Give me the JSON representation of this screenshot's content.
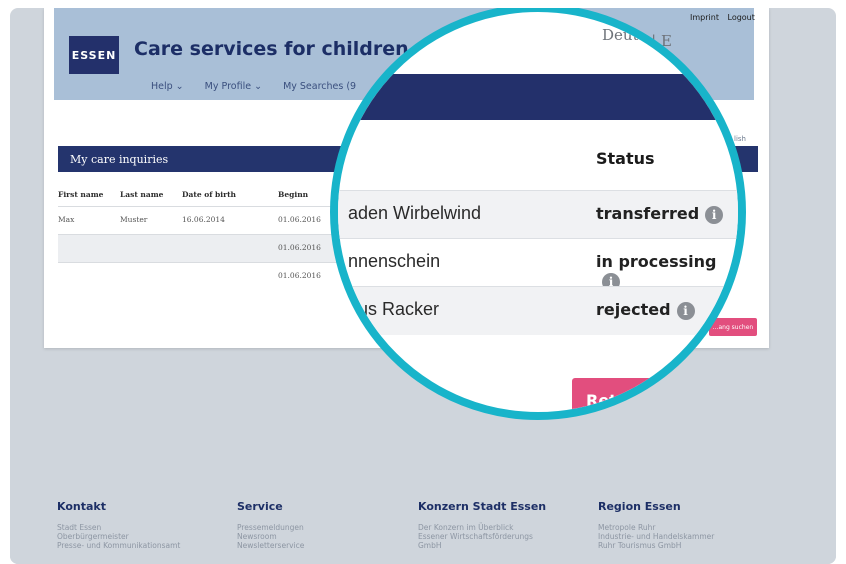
{
  "header": {
    "logo_text": "ESSEN",
    "title": "Care services for children",
    "nav": [
      "Help ⌄",
      "My Profile ⌄",
      "My Searches (9"
    ],
    "language": "Deutsch | E",
    "top_links": [
      "Imprint",
      "Logout"
    ],
    "english_link": "lish"
  },
  "inquiries": {
    "heading": "My care inquiries",
    "columns": [
      "First name",
      "Last name",
      "Date of birth",
      "Beginn"
    ],
    "rows": [
      {
        "first": "Max",
        "last": "Muster",
        "dob": "16.06.2014",
        "begin": "01.06.2016"
      },
      {
        "first": "",
        "last": "",
        "dob": "",
        "begin": "01.06.2016"
      },
      {
        "first": "",
        "last": "",
        "dob": "",
        "begin": "01.06.2016"
      }
    ],
    "small_button": "...ang suchen"
  },
  "magnifier": {
    "language": "Deutsch | E",
    "status_header": "Status",
    "rows": [
      {
        "name": "aden Wirbelwind",
        "status": "transferred"
      },
      {
        "name": "nnenschein",
        "status": "in processing"
      },
      {
        "name": "aus Racker",
        "status": "rejected"
      }
    ],
    "button": "Ret"
  },
  "footer": {
    "columns": [
      {
        "title": "Kontakt",
        "items": [
          "Stadt Essen",
          "Oberbürgermeister",
          "Presse- und Kommunikationsamt"
        ]
      },
      {
        "title": "Service",
        "items": [
          "Pressemeldungen",
          "Newsroom",
          "Newsletterservice"
        ]
      },
      {
        "title": "Konzern Stadt Essen",
        "items": [
          "Der Konzern im Überblick",
          "Essener Wirtschaftsförderungs",
          "GmbH"
        ]
      },
      {
        "title": "Region Essen",
        "items": [
          "Metropole Ruhr",
          "Industrie- und Handelskammer",
          "Ruhr Tourismus GmbH"
        ]
      }
    ]
  },
  "colors": {
    "accent": "#18b4ca",
    "navy": "#23306b",
    "pink": "#e24e7e"
  }
}
